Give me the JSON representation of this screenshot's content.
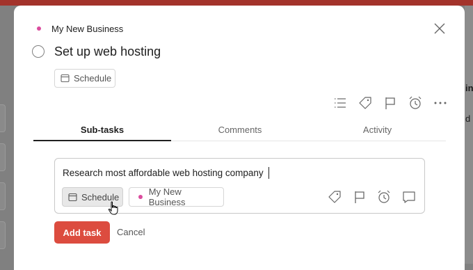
{
  "background": {
    "right_text_line1": "in",
    "right_text_line2": "d"
  },
  "task": {
    "project_name": "My New Business",
    "title": "Set up web hosting",
    "schedule_label": "Schedule"
  },
  "tabs": [
    {
      "label": "Sub-tasks",
      "active": true
    },
    {
      "label": "Comments",
      "active": false
    },
    {
      "label": "Activity",
      "active": false
    }
  ],
  "subtask_editor": {
    "value": "Research most affordable web hosting company",
    "schedule_label": "Schedule",
    "project_label": "My New Business"
  },
  "actions": {
    "add_label": "Add task",
    "cancel_label": "Cancel"
  },
  "colors": {
    "accent": "#dc4c3f",
    "project_dot": "#db4c9e"
  }
}
